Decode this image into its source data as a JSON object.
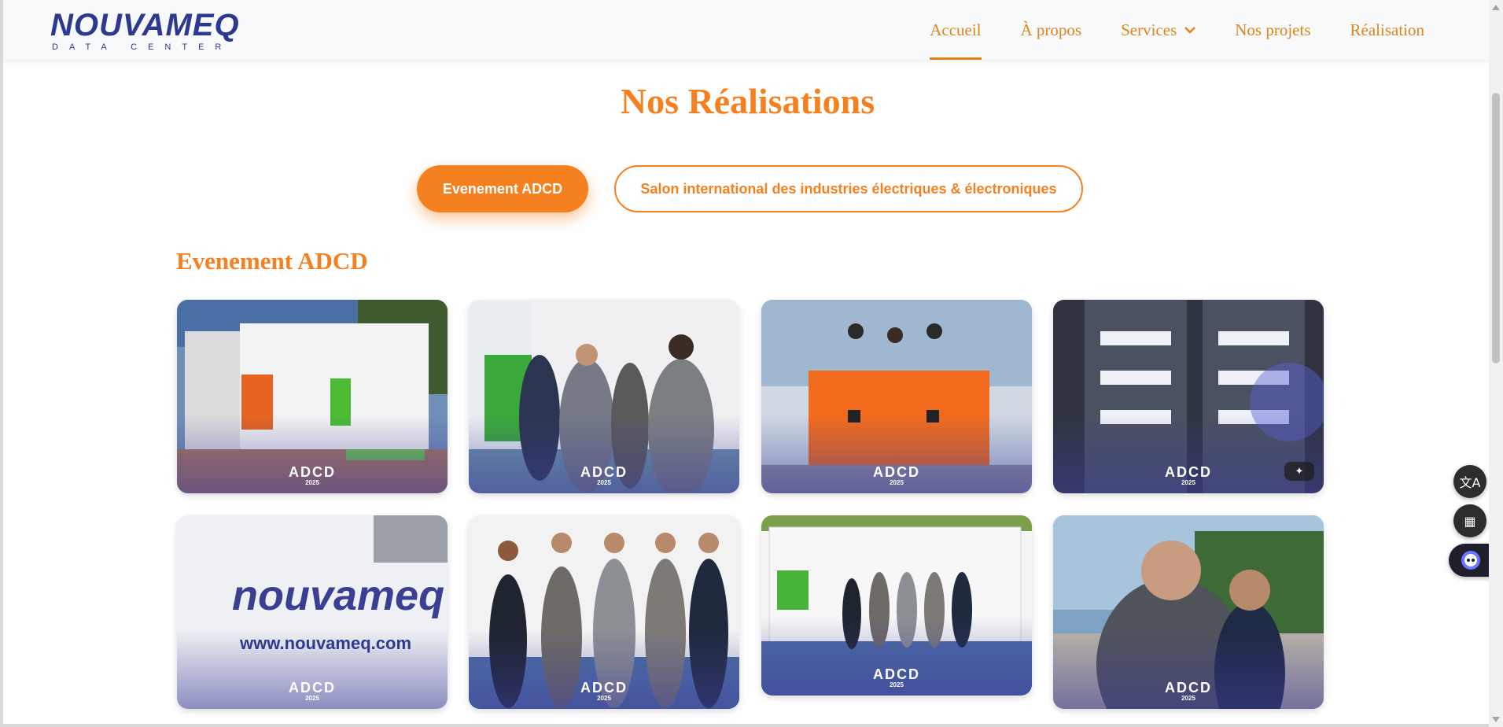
{
  "header": {
    "logo_word": "NOUVAMEQ",
    "logo_sub": "DATA CENTER",
    "nav": [
      {
        "label": "Accueil",
        "active": true
      },
      {
        "label": "À propos"
      },
      {
        "label": "Services",
        "has_dropdown": true
      },
      {
        "label": "Nos projets"
      },
      {
        "label": "Réalisation"
      }
    ]
  },
  "main": {
    "title": "Nos Réalisations",
    "tabs": [
      {
        "label": "Evenement ADCD",
        "selected": true
      },
      {
        "label": "Salon international des industries électriques & électroniques",
        "selected": false
      }
    ],
    "section_title": "Evenement ADCD",
    "watermark": {
      "line1": "ADCD",
      "line2": "2025"
    }
  },
  "colors": {
    "accent": "#f5801f",
    "nav_text": "#e0841a",
    "logo": "#2b3a8e"
  },
  "widgets": {
    "translate_icon": "translate-icon",
    "apps_icon": "apps-grid-icon",
    "assistant_icon": "robot-assistant-icon",
    "magic_icon": "magic-wand-icon"
  }
}
